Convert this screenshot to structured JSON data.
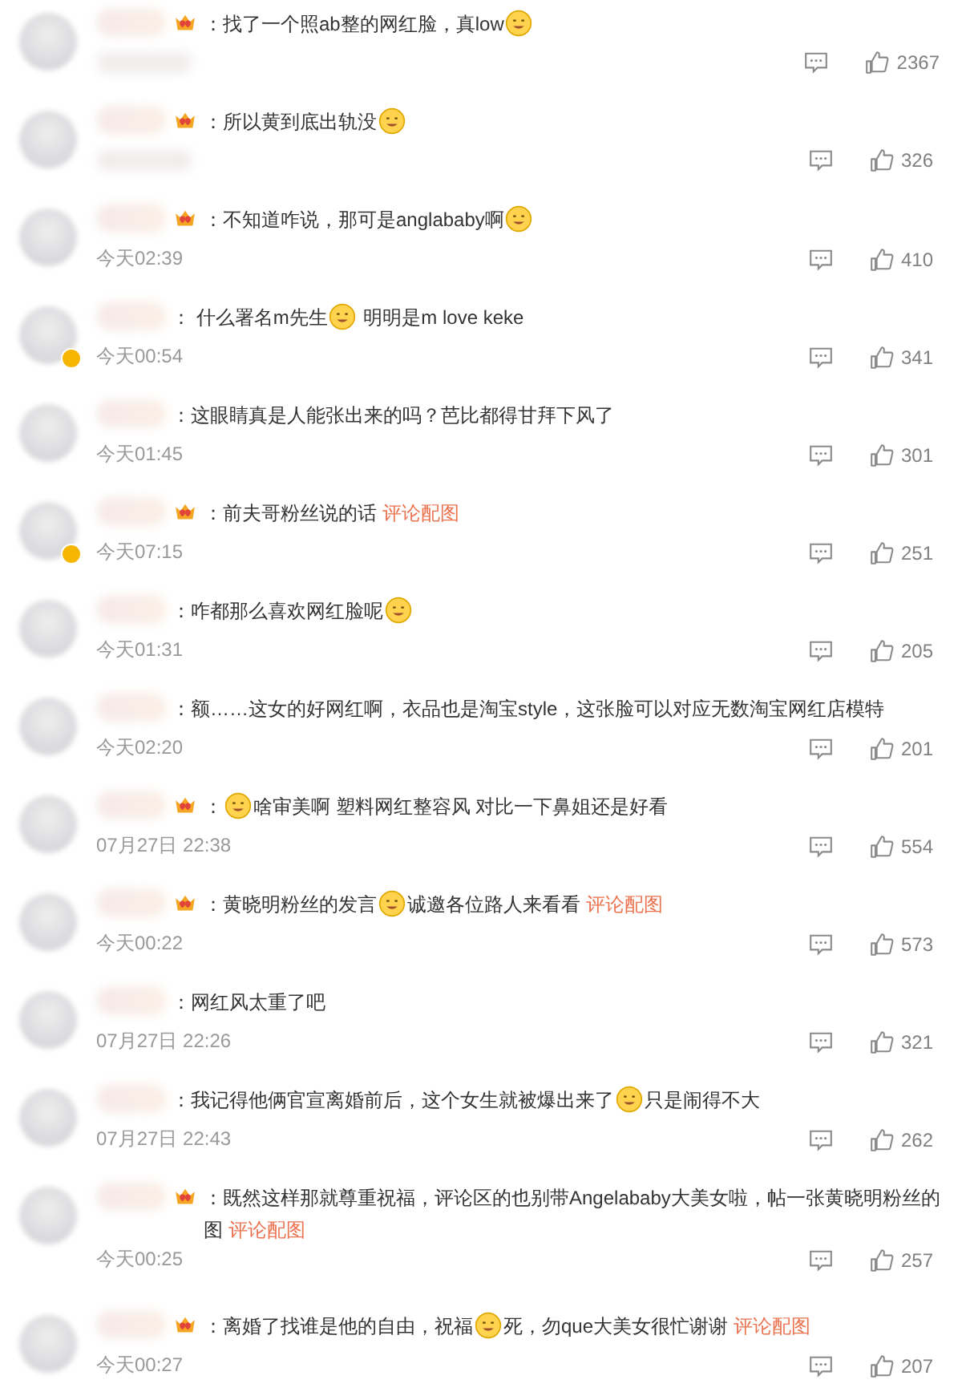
{
  "comments": [
    {
      "verified": false,
      "badge": true,
      "segments": [
        {
          "kind": "text",
          "text": "：找了一个照ab整的网红脸，真low"
        },
        {
          "kind": "emoji"
        }
      ],
      "likes": "2367"
    },
    {
      "verified": false,
      "badge": true,
      "segments": [
        {
          "kind": "text",
          "text": "：所以黄到底出轨没"
        },
        {
          "kind": "emoji"
        }
      ],
      "likes": "326"
    },
    {
      "verified": false,
      "badge": true,
      "segments": [
        {
          "kind": "text",
          "text": "：不知道咋说，那可是anglababy啊"
        },
        {
          "kind": "emoji"
        }
      ],
      "time": "今天02:39",
      "likes": "410"
    },
    {
      "verified": true,
      "badge": false,
      "segments": [
        {
          "kind": "text",
          "text": "： 什么署名m先生"
        },
        {
          "kind": "emoji"
        },
        {
          "kind": "text",
          "text": " 明明是m love keke"
        }
      ],
      "time": "今天00:54",
      "likes": "341"
    },
    {
      "verified": false,
      "badge": false,
      "segments": [
        {
          "kind": "text",
          "text": "：这眼睛真是人能张出来的吗？芭比都得甘拜下风了"
        }
      ],
      "time": "今天01:45",
      "likes": "301"
    },
    {
      "verified": true,
      "badge": true,
      "segments": [
        {
          "kind": "text",
          "text": "：前夫哥粉丝说的话 "
        },
        {
          "kind": "link",
          "text": "评论配图"
        }
      ],
      "time": "今天07:15",
      "likes": "251"
    },
    {
      "verified": false,
      "badge": false,
      "segments": [
        {
          "kind": "text",
          "text": "：咋都那么喜欢网红脸呢"
        },
        {
          "kind": "emoji"
        }
      ],
      "time": "今天01:31",
      "likes": "205"
    },
    {
      "verified": false,
      "badge": false,
      "segments": [
        {
          "kind": "text",
          "text": "：额……这女的好网红啊，衣品也是淘宝style，这张脸可以对应无数淘宝网红店模特"
        }
      ],
      "time": "今天02:20",
      "likes": "201"
    },
    {
      "verified": false,
      "badge": true,
      "segments": [
        {
          "kind": "text",
          "text": "："
        },
        {
          "kind": "emoji"
        },
        {
          "kind": "text",
          "text": "啥审美啊 塑料网红整容风 对比一下鼻姐还是好看"
        }
      ],
      "time": "07月27日 22:38",
      "likes": "554"
    },
    {
      "verified": false,
      "badge": true,
      "segments": [
        {
          "kind": "text",
          "text": "：黄晓明粉丝的发言"
        },
        {
          "kind": "emoji"
        },
        {
          "kind": "text",
          "text": "诚邀各位路人来看看 "
        },
        {
          "kind": "link",
          "text": "评论配图"
        }
      ],
      "time": "今天00:22",
      "likes": "573"
    },
    {
      "verified": false,
      "badge": false,
      "segments": [
        {
          "kind": "text",
          "text": "：网红风太重了吧"
        }
      ],
      "time": "07月27日 22:26",
      "likes": "321"
    },
    {
      "verified": false,
      "badge": false,
      "segments": [
        {
          "kind": "text",
          "text": "：我记得他俩官宣离婚前后，这个女生就被爆出来了"
        },
        {
          "kind": "emoji"
        },
        {
          "kind": "text",
          "text": "只是闹得不大"
        }
      ],
      "time": "07月27日 22:43",
      "likes": "262"
    },
    {
      "verified": false,
      "badge": true,
      "segments": [
        {
          "kind": "text",
          "text": "：既然这样那就尊重祝福，评论区的也别带Angelababy大美女啦，帖一张黄晓明粉丝的图 "
        },
        {
          "kind": "link",
          "text": "评论配图"
        }
      ],
      "time": "今天00:25",
      "likes": "257"
    },
    {
      "verified": false,
      "badge": true,
      "segments": [
        {
          "kind": "text",
          "text": "：离婚了找谁是他的自由，祝福"
        },
        {
          "kind": "emoji"
        },
        {
          "kind": "text",
          "text": "死，勿que大美女很忙谢谢 "
        },
        {
          "kind": "link",
          "text": "评论配图"
        }
      ],
      "time": "今天00:27",
      "likes": "207"
    }
  ]
}
